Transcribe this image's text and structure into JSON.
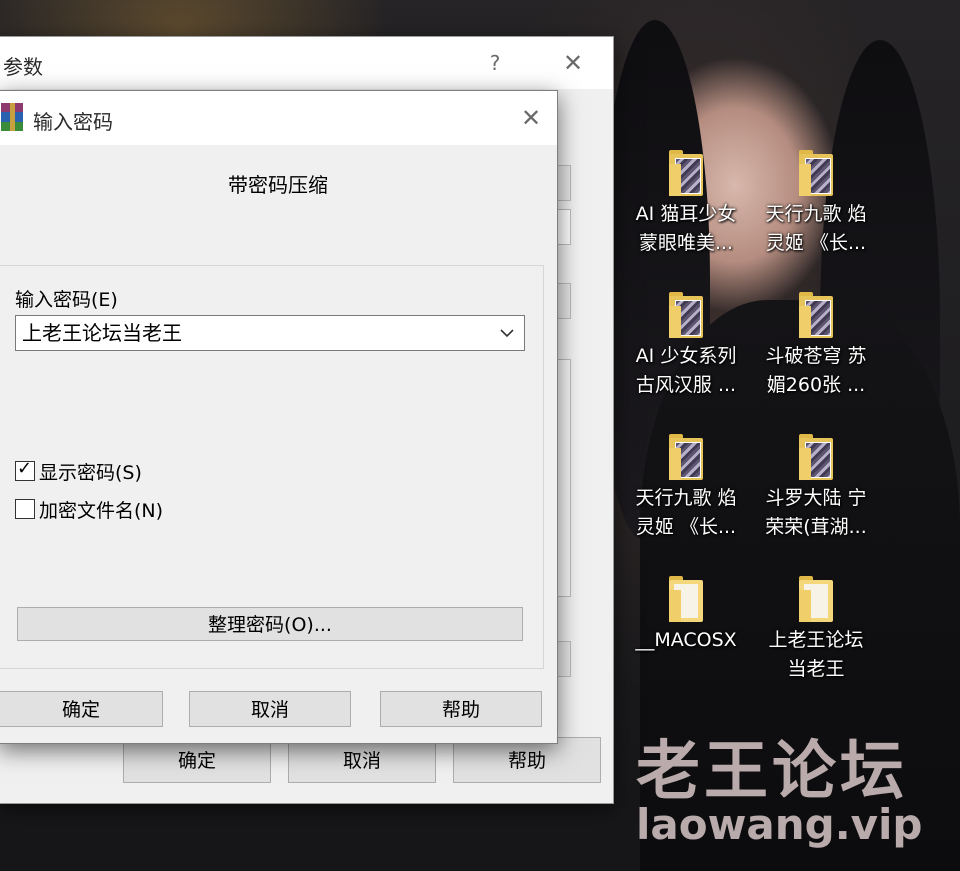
{
  "desktop": {
    "icons": [
      {
        "line1": "AI  猫耳少女",
        "line2": "蒙眼唯美..."
      },
      {
        "line1": "天行九歌 焰",
        "line2": "灵姬 《长..."
      },
      {
        "line1": "AI 少女系列",
        "line2": "古风汉服 ..."
      },
      {
        "line1": "斗破苍穹 苏",
        "line2": "媚260张 ..."
      },
      {
        "line1": "天行九歌 焰",
        "line2": "灵姬 《长..."
      },
      {
        "line1": "斗罗大陆 宁",
        "line2": "荣荣(茸湖..."
      },
      {
        "line1": "__MACOSX",
        "line2": ""
      },
      {
        "line1": "上老王论坛",
        "line2": "当老王"
      }
    ],
    "watermark": {
      "cn": "老王论坛",
      "url": "laowang.vip"
    }
  },
  "params_dialog": {
    "title": "参数",
    "help_glyph": "?",
    "close_glyph": "✕",
    "ok_label": "确定",
    "cancel_label": "取消",
    "help_label": "帮助"
  },
  "password_dialog": {
    "title": "输入密码",
    "close_glyph": "✕",
    "subtitle": "带密码压缩",
    "password_label": "输入密码(E)",
    "password_value": "上老王论坛当老王",
    "show_password_label": "显示密码(S)",
    "show_password_checked": true,
    "encrypt_names_label": "加密文件名(N)",
    "encrypt_names_checked": false,
    "organize_label": "整理密码(O)...",
    "ok_label": "确定",
    "cancel_label": "取消",
    "help_label": "帮助"
  }
}
